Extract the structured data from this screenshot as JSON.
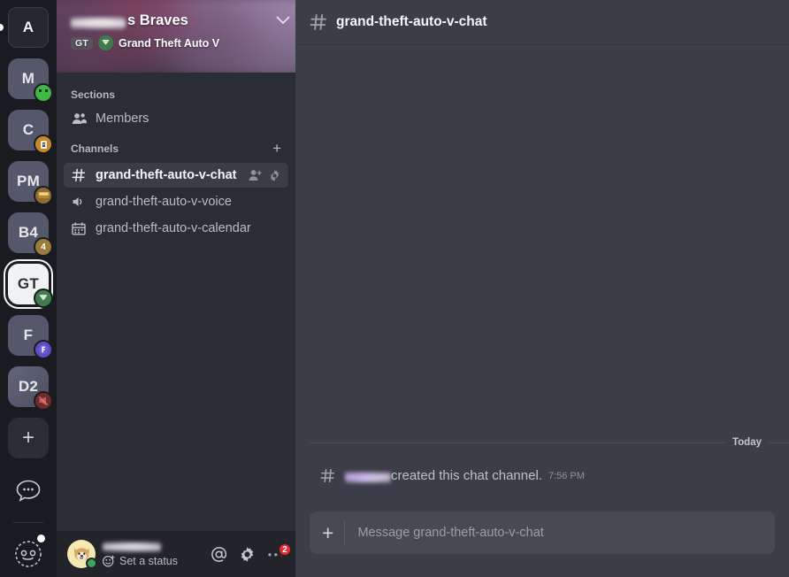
{
  "colors": {
    "rail_bg": "#1a1b20",
    "sidebar_bg": "#2b2d36",
    "main_bg": "#3b3d48",
    "selected_row": "#3a3d47",
    "userbar_bg": "#232429",
    "composer_bg": "#474a55",
    "badge_red": "#e8292f",
    "online_green": "#3ba55d"
  },
  "rail": {
    "servers": [
      {
        "name": "server-icon-a",
        "initials": "A",
        "style": "first",
        "active_pill": true,
        "badge": null
      },
      {
        "name": "server-icon-m",
        "initials": "M",
        "style": "dim",
        "active_pill": false,
        "badge": {
          "name": "minecraft-badge",
          "color": "#4caf50",
          "glyph": "creeper"
        }
      },
      {
        "name": "server-icon-c",
        "initials": "C",
        "style": "dim",
        "active_pill": false,
        "badge": {
          "name": "game-badge",
          "color": "#c68b28",
          "glyph": "card"
        }
      },
      {
        "name": "server-icon-pm",
        "initials": "PM",
        "style": "dim",
        "active_pill": false,
        "badge": {
          "name": "game-badge",
          "color": "#8d6e2a",
          "glyph": "crate"
        }
      },
      {
        "name": "server-icon-b4",
        "initials": "B4",
        "style": "dim",
        "active_pill": false,
        "badge": {
          "name": "count-badge",
          "color": "#9a7b3c",
          "glyph": "4"
        }
      },
      {
        "name": "server-icon-gt",
        "initials": "GT",
        "style": "active",
        "active_pill": false,
        "badge": {
          "name": "gta-badge",
          "color": "#3f7d4a",
          "glyph": "gta"
        }
      },
      {
        "name": "server-icon-f",
        "initials": "F",
        "style": "dim",
        "active_pill": false,
        "badge": {
          "name": "fortnite-badge",
          "color": "#5b4ec4",
          "glyph": "f"
        }
      },
      {
        "name": "server-icon-d2",
        "initials": "D2",
        "style": "d2",
        "active_pill": false,
        "badge": {
          "name": "muted-badge",
          "color": "#6e2c2c",
          "glyph": "muted"
        }
      }
    ],
    "add_server_label": "+",
    "dm_icon": "speech-bubble-icon",
    "discover_icon": "discover-icon"
  },
  "server": {
    "name_suffix": "s Braves",
    "name_blurred": "",
    "game_chip": "GT",
    "game_name": "Grand Theft Auto V",
    "chevron": "chevron-down-icon"
  },
  "sidebar": {
    "sections_header": "Sections",
    "members_label": "Members",
    "channels_header": "Channels",
    "add_channel_label": "+",
    "channels": [
      {
        "name": "grand-theft-auto-v-chat",
        "icon": "hash-icon",
        "selected": true,
        "actions": [
          "add-member-icon",
          "gear-icon"
        ]
      },
      {
        "name": "grand-theft-auto-v-voice",
        "icon": "speaker-icon",
        "selected": false,
        "actions": []
      },
      {
        "name": "grand-theft-auto-v-calendar",
        "icon": "calendar-icon",
        "selected": false,
        "actions": []
      }
    ]
  },
  "user_bar": {
    "username_blurred": "",
    "avatar": "shiba-inu-avatar",
    "status": "online",
    "set_status_label": "Set a status",
    "actions": [
      {
        "name": "mentions-button",
        "icon": "at-icon",
        "badge": null
      },
      {
        "name": "settings-button",
        "icon": "gear-icon",
        "badge": null
      },
      {
        "name": "more-button",
        "icon": "ellipsis-icon",
        "badge": "2"
      }
    ]
  },
  "channel_header": {
    "hash": "#",
    "title": "grand-theft-auto-v-chat"
  },
  "messages": {
    "date_divider": "Today",
    "system_message": {
      "icon": "hash-icon",
      "author_blurred": "",
      "text": "created this chat channel.",
      "timestamp": "7:56 PM"
    }
  },
  "composer": {
    "add_label": "+",
    "placeholder": "Message grand-theft-auto-v-chat"
  }
}
